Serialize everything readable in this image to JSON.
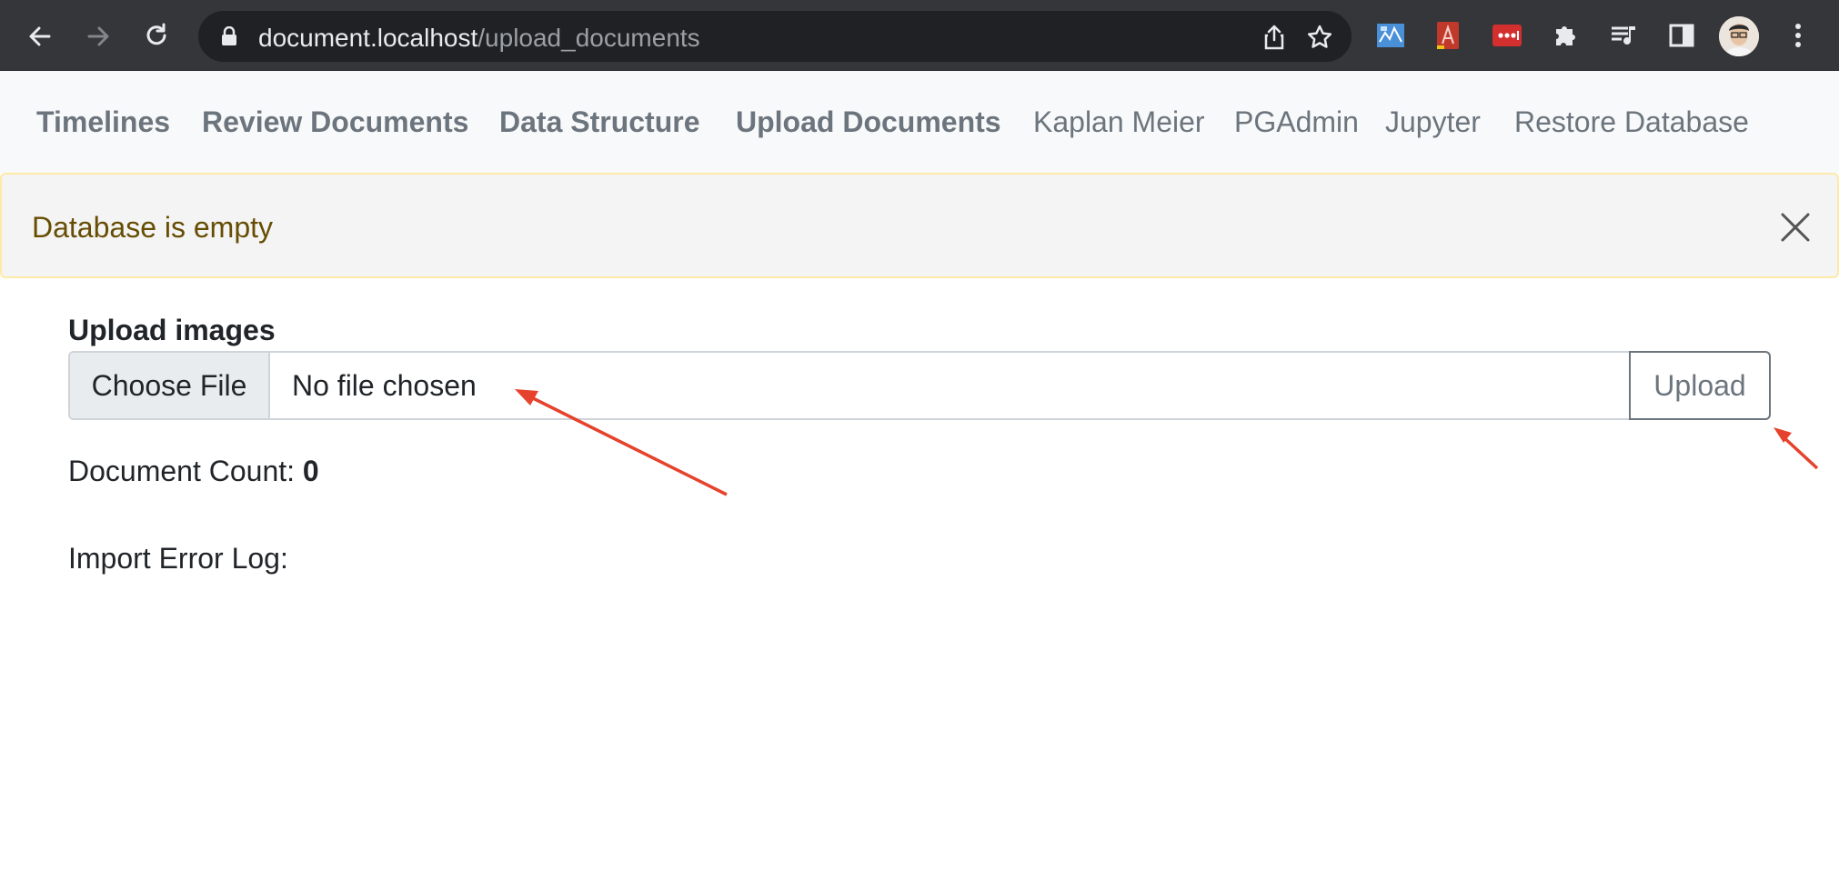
{
  "browser": {
    "url_host": "document.localhost",
    "url_path": "/upload_documents",
    "icons": [
      "back-arrow-icon",
      "forward-arrow-icon",
      "reload-icon",
      "lock-icon",
      "share-icon",
      "star-icon",
      "extension-icon",
      "puzzle-icon",
      "media-queue-icon",
      "side-panel-icon",
      "profile-avatar",
      "kebab-menu-icon"
    ]
  },
  "nav": {
    "links": [
      {
        "label": "Timelines"
      },
      {
        "label": "Review Documents"
      },
      {
        "label": "Data Structure"
      },
      {
        "label": "Upload Documents"
      },
      {
        "label": "Kaplan Meier"
      },
      {
        "label": "PGAdmin"
      },
      {
        "label": "Jupyter"
      },
      {
        "label": "Restore Database"
      }
    ]
  },
  "alert": {
    "message": "Database is empty"
  },
  "upload": {
    "label": "Upload images",
    "choose_label": "Choose File",
    "file_status": "No file chosen",
    "submit_label": "Upload"
  },
  "stats": {
    "count_label": "Document Count:",
    "count_value": "0",
    "log_label": "Import Error Log:"
  },
  "colors": {
    "annotation_arrow": "#e5432d",
    "alert_border": "#fdeaa8",
    "alert_text": "#664d03"
  }
}
